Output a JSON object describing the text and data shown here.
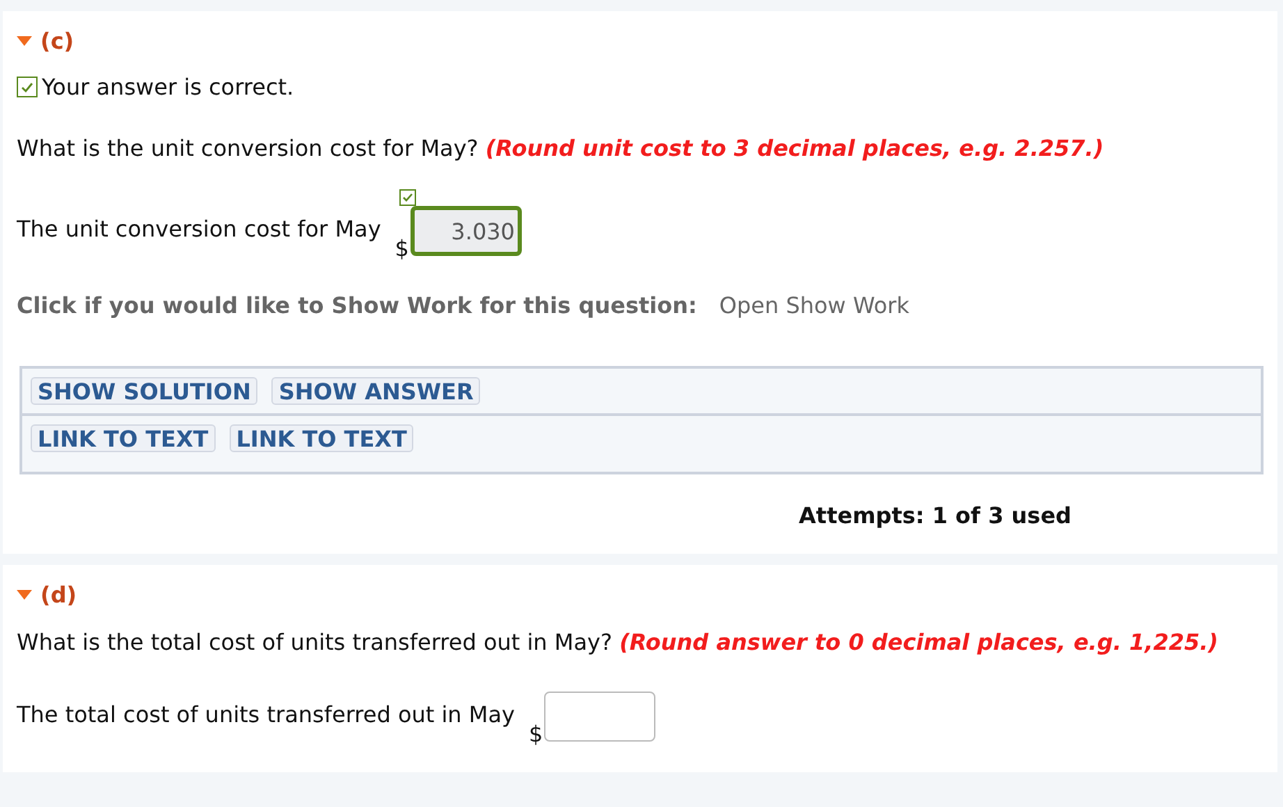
{
  "parts": [
    {
      "label": "(c)",
      "expanded": true,
      "result": {
        "correct": true,
        "text": "Your answer is correct."
      },
      "question": "What is the unit conversion cost for May? **(Round unit cost to 3 decimal places, e.g. 2.257.)**",
      "answer": {
        "label": "The unit conversion cost for May",
        "currency": "$",
        "value": "3.030",
        "correct": true
      },
      "show_work": {
        "prompt": "Click if you would like to Show Work for this question:",
        "link": "Open Show Work"
      },
      "button_rows": [
        [
          "SHOW SOLUTION",
          "SHOW ANSWER"
        ],
        [
          "LINK TO TEXT",
          "LINK TO TEXT"
        ]
      ],
      "attempts": "Attempts: 1 of 3 used"
    },
    {
      "label": "(d)",
      "expanded": true,
      "question": "What is the total cost of units transferred out in May? **(Round answer to 0 decimal places, e.g. 1,225.)**",
      "answer": {
        "label": "The total cost of units transferred out in May",
        "currency": "$",
        "correct": false
      }
    }
  ]
}
